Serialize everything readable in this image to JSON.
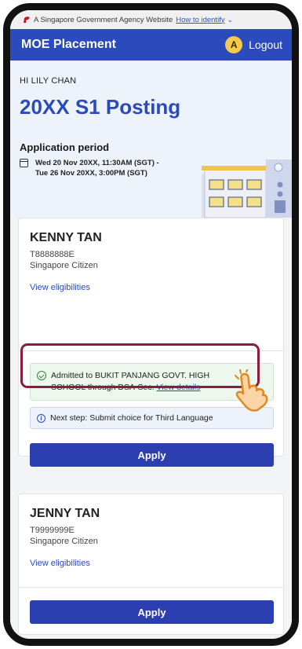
{
  "gov_banner": {
    "text": "A Singapore Government Agency Website",
    "link": "How to identify"
  },
  "header": {
    "brand": "MOE Placement",
    "avatar_initial": "A",
    "logout_label": "Logout"
  },
  "hero": {
    "greeting": "HI LILY CHAN",
    "title": "20XX S1 Posting",
    "period_title": "Application period",
    "period_line1": "Wed 20 Nov 20XX, 11:30AM (SGT) -",
    "period_line2": "Tue 26 Nov 20XX, 3:00PM (SGT)"
  },
  "children": [
    {
      "name": "KENNY TAN",
      "nric": "T8888888E",
      "citizenship": "Singapore Citizen",
      "eligibility_link": "View eligibilities",
      "admission_line1": "Admitted to BUKIT PANJANG GOVT. HIGH",
      "admission_line2": "SCHOOL through DSA-Sec.",
      "view_details": "View details",
      "next_step": "Next step: Submit choice for Third Language",
      "apply_label": "Apply"
    },
    {
      "name": "JENNY TAN",
      "nric": "T9999999E",
      "citizenship": "Singapore Citizen",
      "eligibility_link": "View eligibilities",
      "apply_label": "Apply"
    }
  ],
  "colors": {
    "primary": "#2b4bbd",
    "button": "#2b3fb0",
    "highlight": "#8c1c3a",
    "success": "#2f8a3a",
    "avatar": "#f5c94d"
  }
}
